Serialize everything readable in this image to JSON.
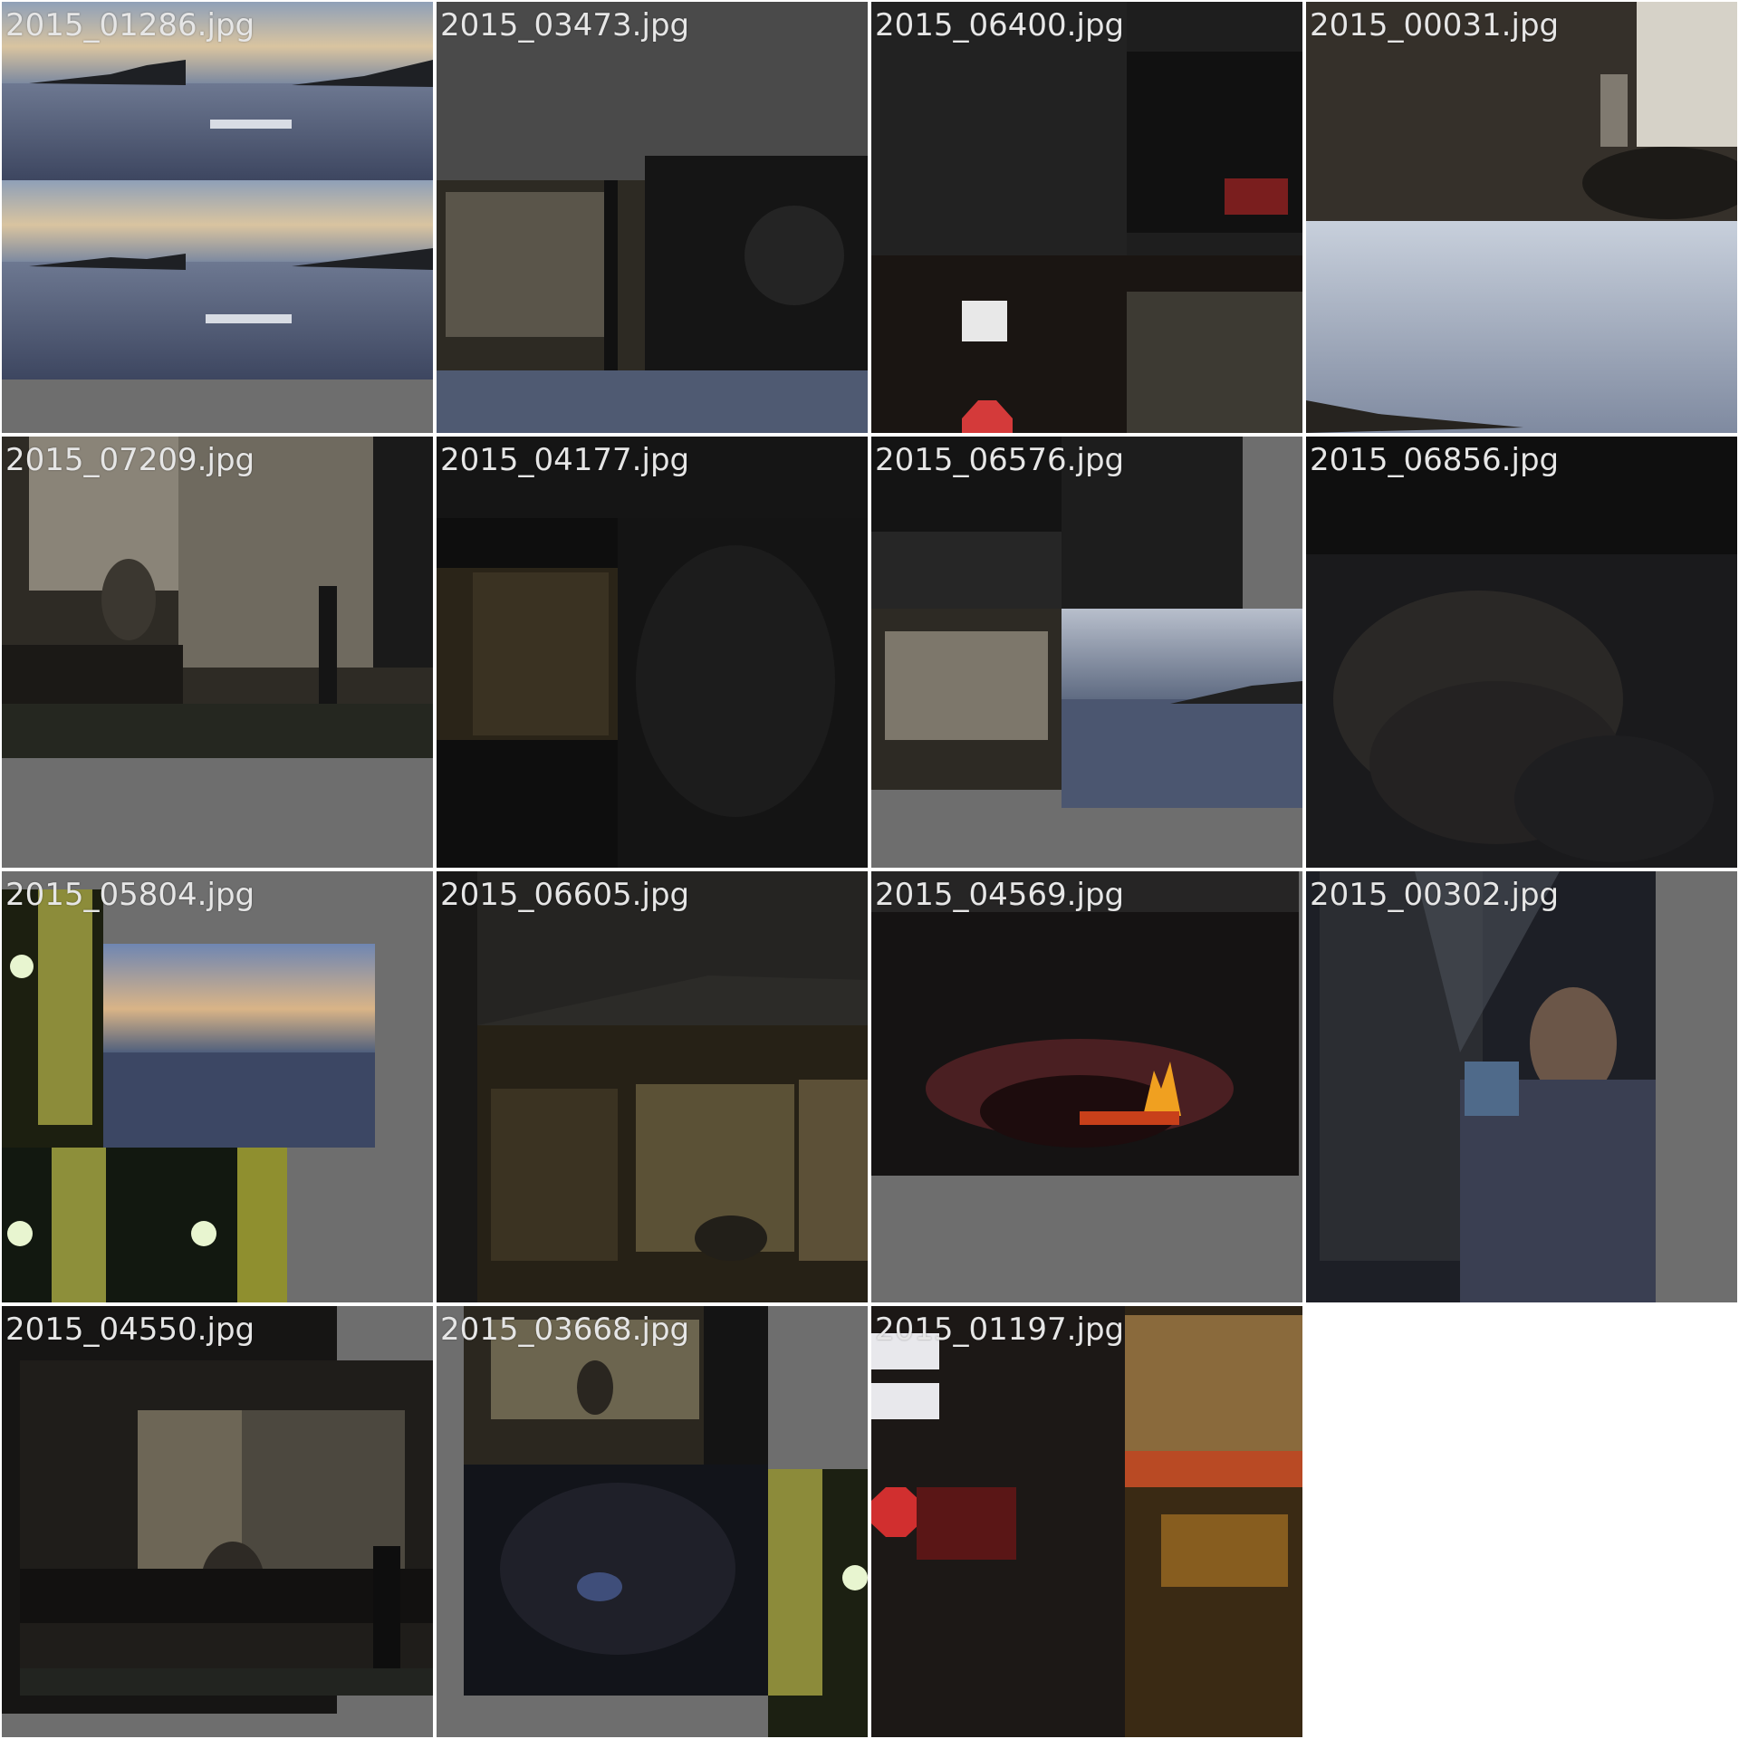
{
  "gallery": {
    "items": [
      {
        "filename": "2015_01286.jpg",
        "scene": "lake-sunset-boat"
      },
      {
        "filename": "2015_03473.jpg",
        "scene": "shed-cat-sky"
      },
      {
        "filename": "2015_06400.jpg",
        "scene": "dark-street-signs"
      },
      {
        "filename": "2015_00031.jpg",
        "scene": "window-table-sky"
      },
      {
        "filename": "2015_07209.jpg",
        "scene": "shed-sitting-man"
      },
      {
        "filename": "2015_04177.jpg",
        "scene": "dark-shed"
      },
      {
        "filename": "2015_06576.jpg",
        "scene": "street-rain-collage"
      },
      {
        "filename": "2015_06856.jpg",
        "scene": "cat-closeup"
      },
      {
        "filename": "2015_05804.jpg",
        "scene": "street-lights-lake"
      },
      {
        "filename": "2015_06605.jpg",
        "scene": "sidewalk-shed"
      },
      {
        "filename": "2015_04569.jpg",
        "scene": "fire-pit"
      },
      {
        "filename": "2015_00302.jpg",
        "scene": "man-drinking"
      },
      {
        "filename": "2015_04550.jpg",
        "scene": "shed-sitting-man-2"
      },
      {
        "filename": "2015_03668.jpg",
        "scene": "shed-cat-street"
      },
      {
        "filename": "2015_01197.jpg",
        "scene": "stop-sign-canal"
      }
    ]
  },
  "colors": {
    "cell_background": "#6e6e6e",
    "page_background": "#ffffff",
    "label_text": "#e6e6e6"
  }
}
